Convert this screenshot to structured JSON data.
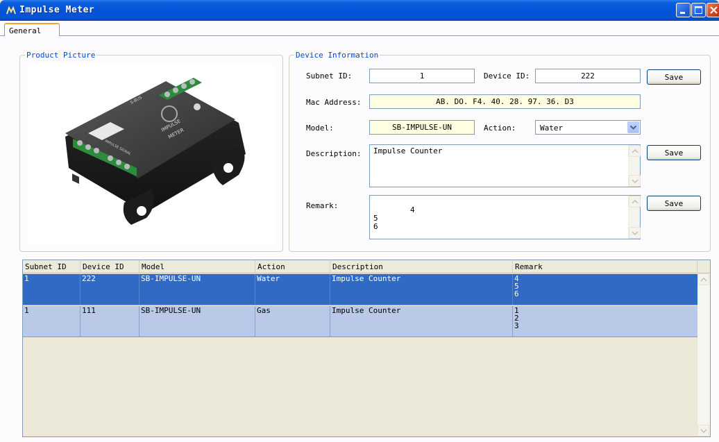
{
  "window": {
    "title": "Impulse Meter"
  },
  "tabs": [
    {
      "label": "General"
    }
  ],
  "product_picture": {
    "title": "Product Picture",
    "image": "impulse-meter-device-photo",
    "device_labels": {
      "logo": "S-BUS",
      "name_line1": "IMPULSE",
      "name_line2": "METER",
      "signal": "IMPULSE SIGNAL"
    }
  },
  "device_info": {
    "title": "Device Information",
    "subnet_id_label": "Subnet ID:",
    "subnet_id_value": "1",
    "device_id_label": "Device ID:",
    "device_id_value": "222",
    "mac_label": "Mac Address:",
    "mac_value": "AB. DO. F4. 40. 28. 97. 36. D3",
    "model_label": "Model:",
    "model_value": "SB-IMPULSE-UN",
    "action_label": "Action:",
    "action_value": "Water",
    "description_label": "Description:",
    "description_value": "Impulse Counter",
    "remark_label": "Remark:",
    "remark_value": "4\n5\n6",
    "save_label": "Save"
  },
  "grid": {
    "columns": [
      "Subnet ID",
      "Device ID",
      "Model",
      "Action",
      "Description",
      "Remark"
    ],
    "rows": [
      {
        "subnet": "1",
        "device": "222",
        "model": "SB-IMPULSE-UN",
        "action": "Water",
        "description": "Impulse Counter",
        "remark": "4\n5\n6",
        "selected": true
      },
      {
        "subnet": "1",
        "device": "111",
        "model": "SB-IMPULSE-UN",
        "action": "Gas",
        "description": "Impulse Counter",
        "remark": "1\n2\n3",
        "selected": false
      }
    ]
  },
  "colors": {
    "titlebar": "#0454d8",
    "group_title": "#0046d5",
    "selected_row": "#316ac5",
    "row": "#b9c9e7",
    "mac_bg": "#ffffe1"
  }
}
